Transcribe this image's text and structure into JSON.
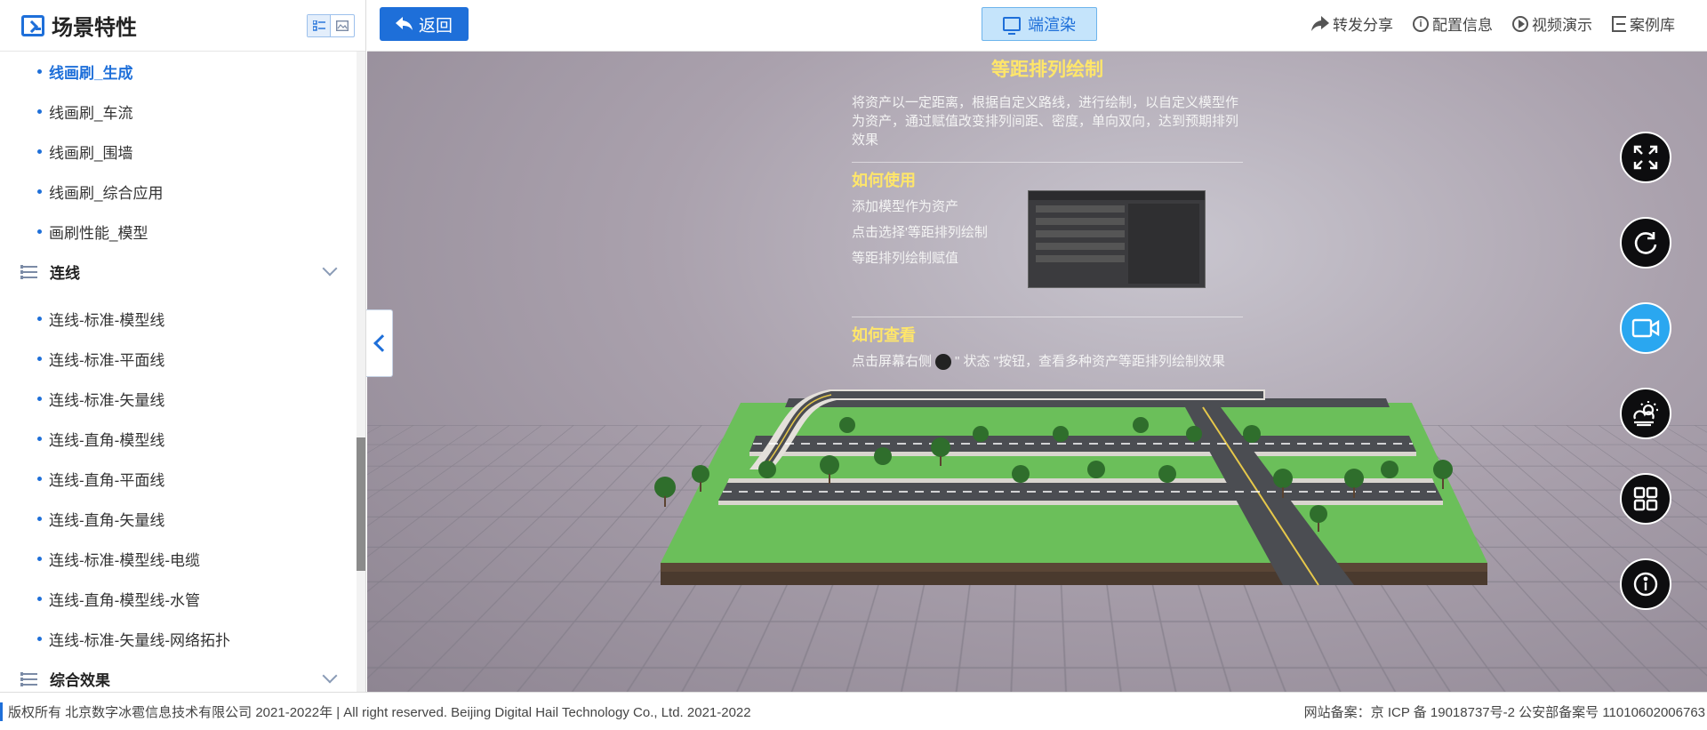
{
  "sidebar": {
    "title": "场景特性",
    "items_top": [
      {
        "label": "线画刷_生成",
        "active": true
      },
      {
        "label": "线画刷_车流"
      },
      {
        "label": "线画刷_围墙"
      },
      {
        "label": "线画刷_综合应用"
      },
      {
        "label": "画刷性能_模型"
      }
    ],
    "group_lianxian": "连线",
    "items_lianxian": [
      "连线-标准-模型线",
      "连线-标准-平面线",
      "连线-标准-矢量线",
      "连线-直角-模型线",
      "连线-直角-平面线",
      "连线-直角-矢量线",
      "连线-标准-模型线-电缆",
      "连线-直角-模型线-水管",
      "连线-标准-矢量线-网络拓扑"
    ],
    "group_zonghe": "综合效果"
  },
  "topbar": {
    "back_label": "返回",
    "render_label": "端渲染",
    "actions": [
      "转发分享",
      "配置信息",
      "视频演示",
      "案例库"
    ]
  },
  "info": {
    "title": "等距排列绘制",
    "desc": "将资产以一定距离，根据自定义路线，进行绘制，以自定义模型作为资产，通过赋值改变排列间距、密度，单向双向，达到预期排列效果",
    "how_use_title": "如何使用",
    "how_use_steps": [
      "添加模型作为资产",
      "点击选择'等距排列绘制",
      "等距排列绘制赋值"
    ],
    "how_view_title": "如何查看",
    "how_view_text_a": "点击屏幕右侧",
    "how_view_text_b": "\" 状态 \"按钮，查看多种资产等距排列绘制效果"
  },
  "footer": {
    "left": "版权所有 北京数字冰雹信息技术有限公司 2021-2022年 | All right reserved. Beijing Digital Hail Technology Co., Ltd. 2021-2022",
    "right": "网站备案：京 ICP 备 19018737号-2 公安部备案号 11010602006763"
  },
  "colors": {
    "brand": "#1e6fd9",
    "accent": "#2aa7f0",
    "title_yellow": "#ffe66a"
  },
  "icons": [
    "screen-icon",
    "list-view-icon",
    "image-view-icon",
    "back-arrow-icon",
    "monitor-icon",
    "share-icon",
    "info-icon",
    "play-icon",
    "exit-icon",
    "fullscreen-icon",
    "refresh-icon",
    "video-icon",
    "weather-icon",
    "grid-icon",
    "info-circle-icon"
  ]
}
